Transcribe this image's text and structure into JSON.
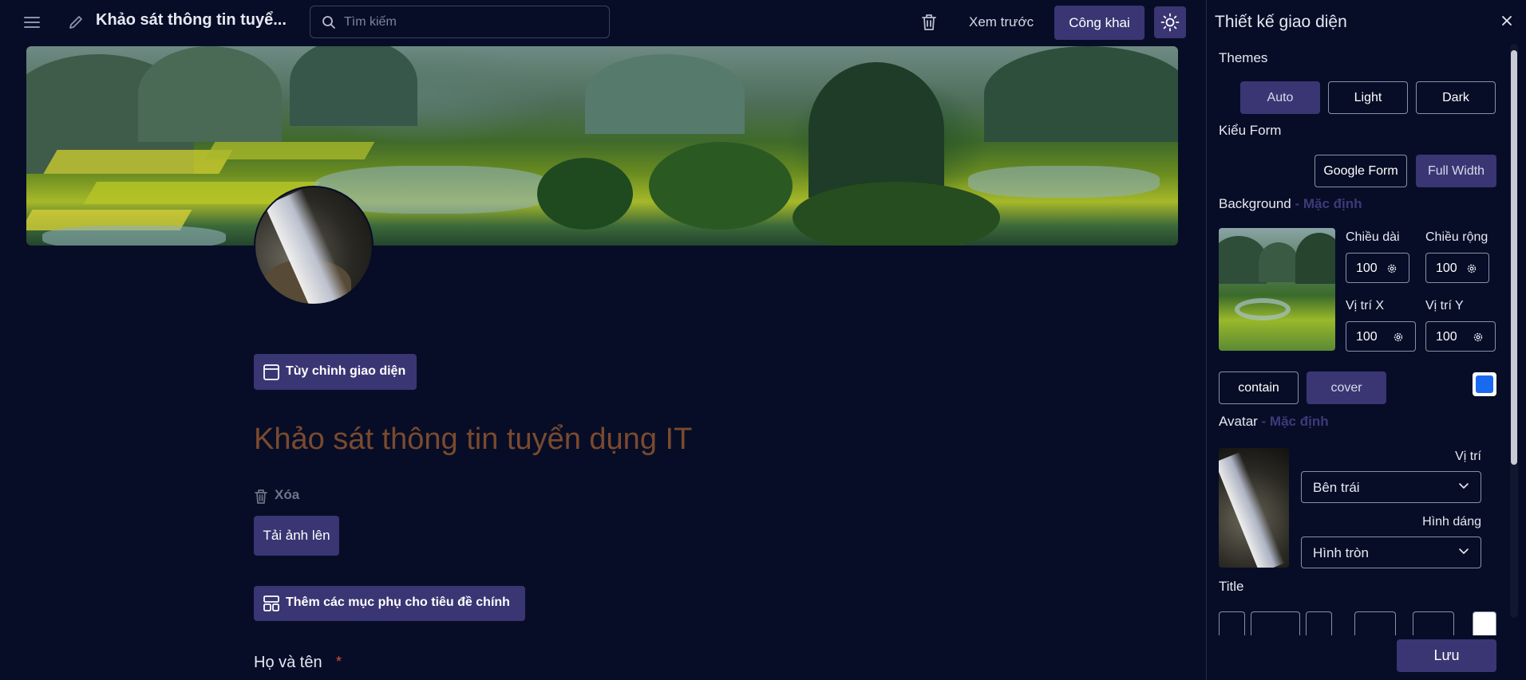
{
  "header": {
    "form_title": "Khảo sát thông tin tuyể...",
    "search_placeholder": "Tìm kiếm",
    "preview_label": "Xem trước",
    "publish_label": "Công khai"
  },
  "main": {
    "customize_label": "Tùy chỉnh giao diện",
    "title": "Khảo sát thông tin tuyển dụng IT",
    "delete_label": "Xóa",
    "upload_label": "Tải ảnh lên",
    "subtitle_items_label": "Thêm các mục phụ cho tiêu đề chính",
    "first_field_label": "Họ và tên",
    "required_mark": "*"
  },
  "panel": {
    "title": "Thiết kế giao diện",
    "themes_label": "Themes",
    "themes": [
      "Auto",
      "Light",
      "Dark"
    ],
    "themes_selected": "Auto",
    "form_style_label": "Kiểu Form",
    "form_styles": [
      "Google Form",
      "Full Width"
    ],
    "form_style_selected": "Full Width",
    "background_label": "Background",
    "background_default": " - Mặc định",
    "length_label": "Chiều dài",
    "length_value": "100",
    "width_label": "Chiều rộng",
    "width_value": "100",
    "pos_x_label": "Vị trí X",
    "pos_x_value": "100",
    "pos_y_label": "Vị trí Y",
    "pos_y_value": "100",
    "fit_options": [
      "contain",
      "cover"
    ],
    "fit_selected": "cover",
    "bg_color": "#1a6af0",
    "avatar_label": "Avatar",
    "avatar_default": " - Mặc định",
    "position_label": "Vị trí",
    "position_value": "Bên trái",
    "shape_label": "Hình dáng",
    "shape_value": "Hình tròn",
    "title_label": "Title",
    "save_label": "Lưu"
  },
  "colors": {
    "accent": "#3a3573",
    "background": "#070d26",
    "title_color": "#7a4a2e",
    "required": "#e0463c"
  }
}
